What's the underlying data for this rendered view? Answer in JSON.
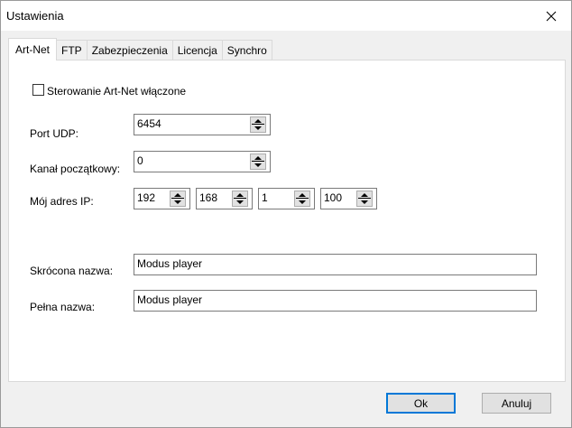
{
  "window": {
    "title": "Ustawienia"
  },
  "tabs": [
    {
      "label": "Art-Net",
      "active": true
    },
    {
      "label": "FTP",
      "active": false
    },
    {
      "label": "Zabezpieczenia",
      "active": false
    },
    {
      "label": "Licencja",
      "active": false
    },
    {
      "label": "Synchro",
      "active": false
    }
  ],
  "artnet": {
    "enable_label": "Sterowanie Art-Net włączone",
    "enabled": false,
    "port_label": "Port UDP:",
    "port_value": "6454",
    "channel_label": "Kanał początkowy:",
    "channel_value": "0",
    "ip_label": "Mój adres IP:",
    "ip": [
      "192",
      "168",
      "1",
      "100"
    ],
    "short_name_label": "Skrócona nazwa:",
    "short_name_value": "Modus player",
    "long_name_label": "Pełna nazwa:",
    "long_name_value": "Modus player"
  },
  "buttons": {
    "ok": "Ok",
    "cancel": "Anuluj"
  },
  "icons": {
    "close": "close-icon",
    "spin": "spin-arrows-icon"
  },
  "colors": {
    "accent": "#0078d7"
  }
}
